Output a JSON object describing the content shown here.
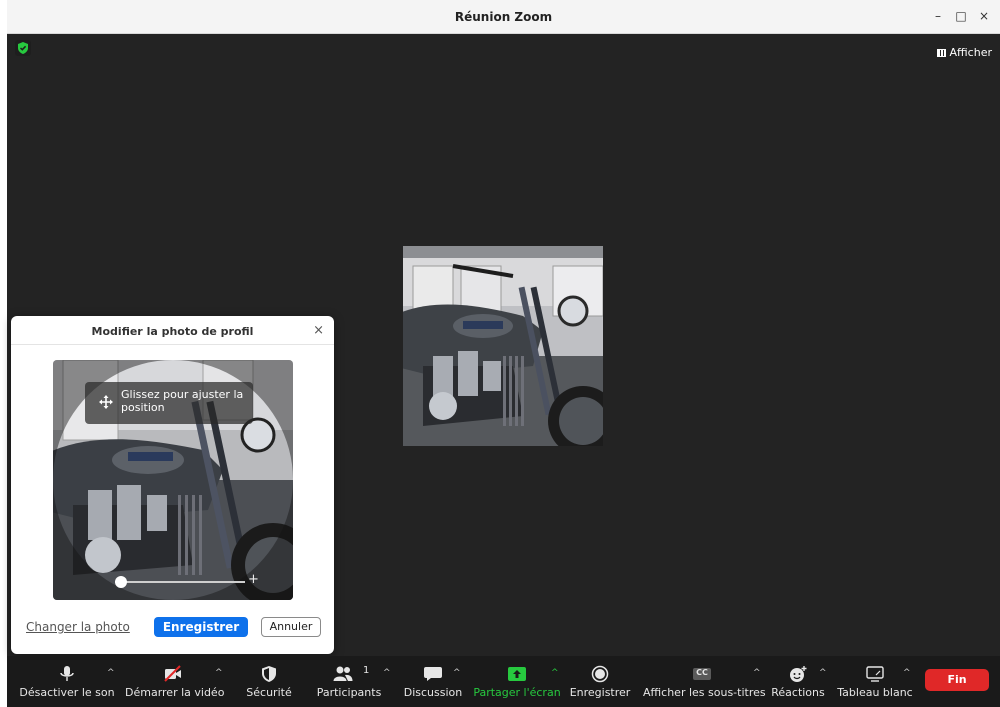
{
  "window": {
    "title": "Réunion Zoom",
    "controls": [
      "–",
      "□",
      "×"
    ]
  },
  "view_button": {
    "label": "Afficher"
  },
  "dialog": {
    "title": "Modifier la photo de profil",
    "close": "×",
    "hint": "Glissez pour ajuster la position",
    "zoom_plus": "+",
    "zoom_level": 0.0,
    "change_photo": "Changer la photo",
    "save": "Enregistrer",
    "cancel": "Annuler"
  },
  "toolbar": {
    "items": [
      {
        "label": "Désactiver le son",
        "icon": "microphone-icon"
      },
      {
        "label": "Démarrer la vidéo",
        "icon": "video-off-icon"
      },
      {
        "label": "Sécurité",
        "icon": "shield-icon"
      },
      {
        "label": "Participants",
        "icon": "participants-icon",
        "count": "1"
      },
      {
        "label": "Discussion",
        "icon": "chat-icon"
      },
      {
        "label": "Partager l'écran",
        "icon": "share-screen-icon"
      },
      {
        "label": "Enregistrer",
        "icon": "record-icon"
      },
      {
        "label": "Afficher les sous-titres",
        "icon": "cc-icon",
        "badge": "CC"
      },
      {
        "label": "Réactions",
        "icon": "reaction-icon"
      },
      {
        "label": "Tableau blanc",
        "icon": "whiteboard-icon"
      }
    ],
    "end": "Fin"
  },
  "colors": {
    "accent": "#0e71eb",
    "end": "#e02828",
    "share": "#27c93f",
    "background": "#232323",
    "toolbar": "#1a1a1a"
  }
}
